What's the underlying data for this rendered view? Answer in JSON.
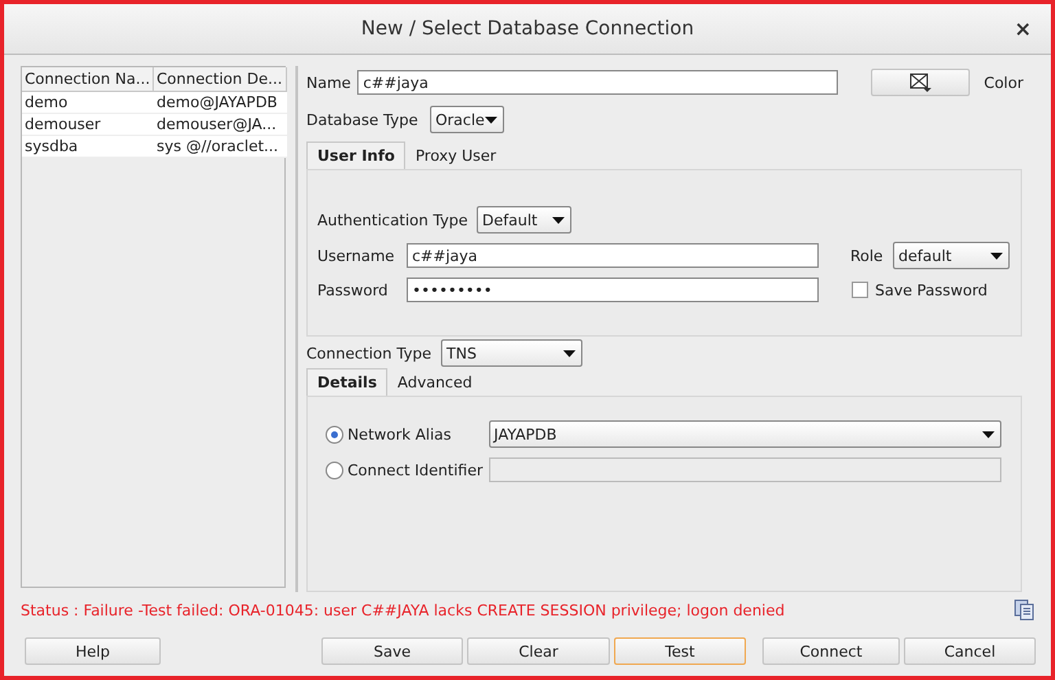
{
  "window": {
    "title": "New / Select Database Connection",
    "close": "×"
  },
  "connections": {
    "columns": [
      "Connection Na...",
      "Connection De..."
    ],
    "rows": [
      {
        "name": "demo",
        "details": "demo@JAYAPDB"
      },
      {
        "name": "demouser",
        "details": "demouser@JA..."
      },
      {
        "name": "sysdba",
        "details": "sys @//oraclet..."
      }
    ]
  },
  "form": {
    "name_label": "Name",
    "name": "c##jaya",
    "color_label": "Color",
    "database_type_label": "Database Type",
    "database_type": "Oracle",
    "tabs": [
      {
        "label": "User Info",
        "selected": true
      },
      {
        "label": "Proxy User",
        "selected": false
      }
    ],
    "authentication_type_label": "Authentication Type",
    "authentication_type": "Default",
    "username_label": "Username",
    "username": "c##jaya",
    "role_label": "Role",
    "role": "default",
    "password_label": "Password",
    "password": "•••••••••",
    "save_password": {
      "label": "Save Password",
      "checked": false
    },
    "connection_type_label": "Connection Type",
    "connection_type": "TNS",
    "detail_tabs": [
      {
        "label": "Details",
        "selected": true
      },
      {
        "label": "Advanced",
        "selected": false
      }
    ],
    "network_alias": {
      "label": "Network Alias",
      "selected": true,
      "value": "JAYAPDB"
    },
    "connect_identifier": {
      "label": "Connect Identifier",
      "selected": false
    }
  },
  "status": "Status : Failure -Test failed: ORA-01045: user C##JAYA lacks CREATE SESSION privilege; logon denied",
  "buttons": [
    {
      "label": "Help",
      "focused": false
    },
    {
      "label": "Save",
      "focused": false
    },
    {
      "label": "Clear",
      "focused": false
    },
    {
      "label": "Test",
      "focused": true
    },
    {
      "label": "Connect",
      "focused": false
    },
    {
      "label": "Cancel",
      "focused": false
    }
  ]
}
